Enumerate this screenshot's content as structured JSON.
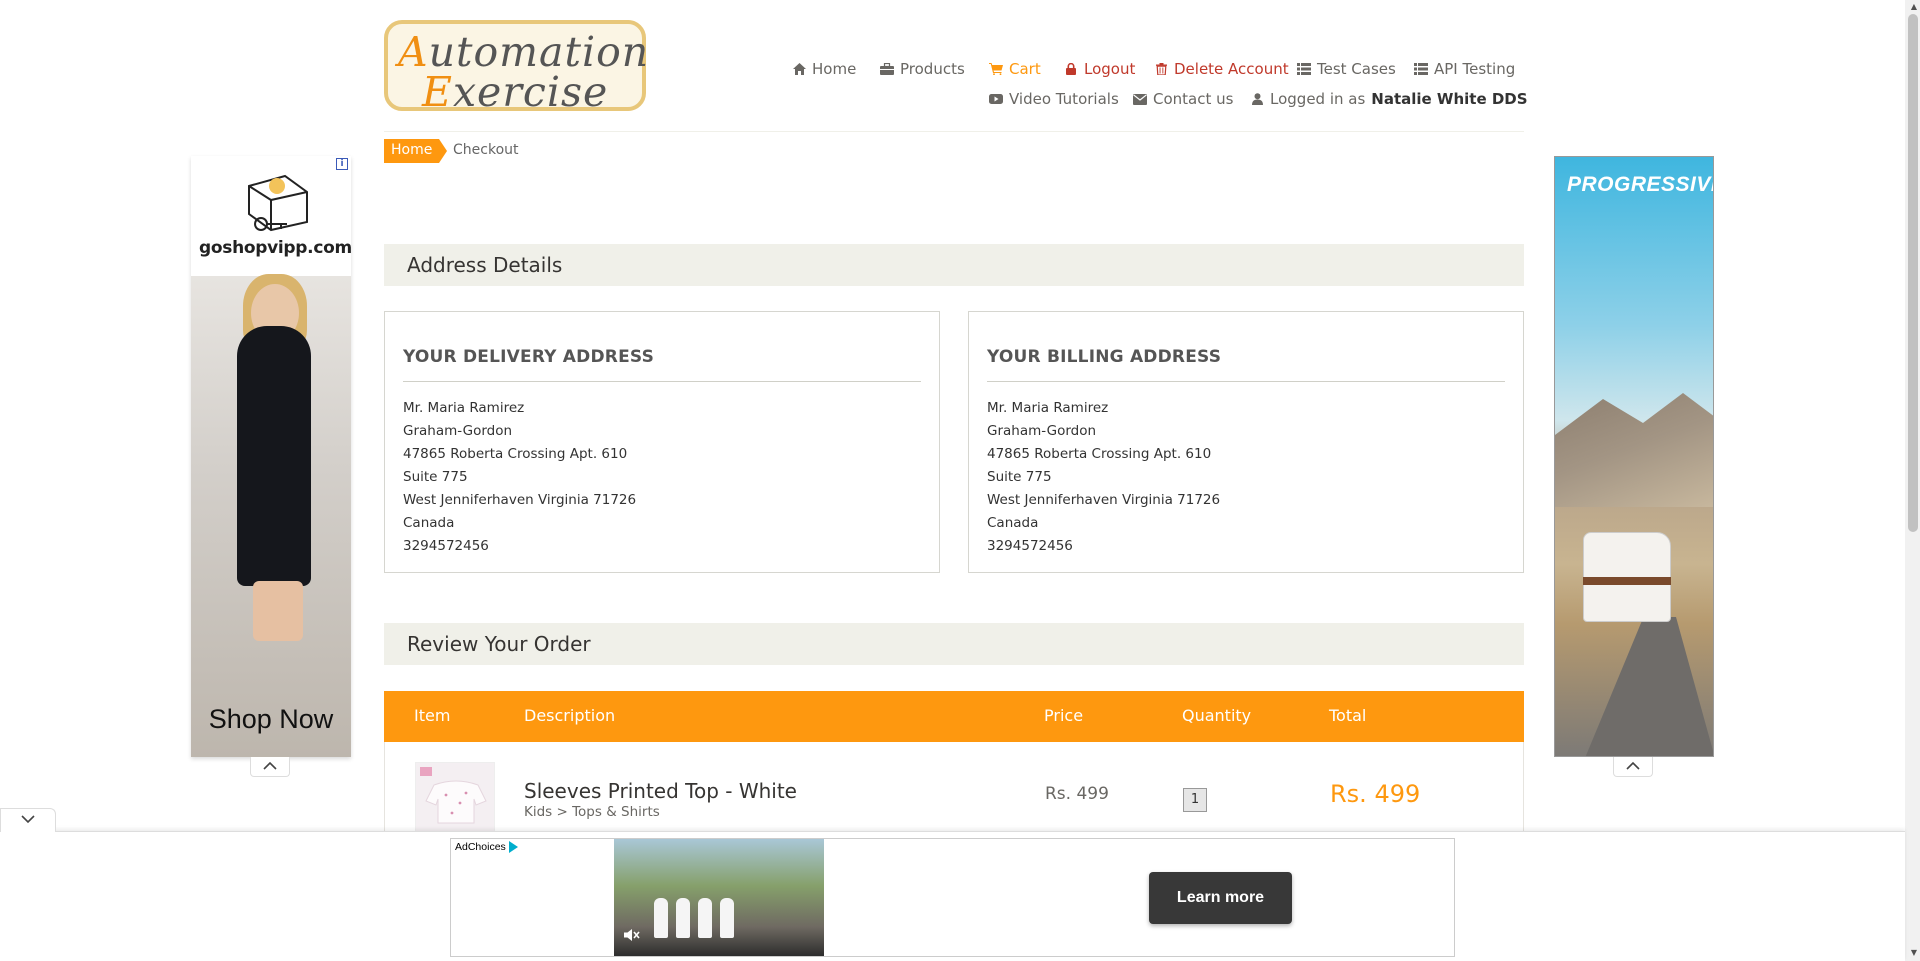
{
  "logo": {
    "line1_cap": "A",
    "line1_rest": "utomation",
    "line2_cap": "E",
    "line2_rest": "xercise"
  },
  "nav": {
    "home": "Home",
    "products": "Products",
    "cart": "Cart",
    "logout": "Logout",
    "delete_account": "Delete Account",
    "test_cases": "Test Cases",
    "api_testing": "API Testing",
    "video_tutorials": "Video Tutorials",
    "contact_us": "Contact us",
    "logged_in_prefix": "Logged in as",
    "logged_in_user": "Natalie White DDS"
  },
  "breadcrumb": {
    "home": "Home",
    "current": "Checkout"
  },
  "address_section": {
    "title": "Address Details"
  },
  "delivery": {
    "title": "YOUR DELIVERY ADDRESS",
    "lines": [
      "Mr. Maria Ramirez",
      "Graham-Gordon",
      "47865 Roberta Crossing Apt. 610",
      "Suite 775",
      "West Jenniferhaven Virginia 71726",
      "Canada",
      "3294572456"
    ]
  },
  "billing": {
    "title": "YOUR BILLING ADDRESS",
    "lines": [
      "Mr. Maria Ramirez",
      "Graham-Gordon",
      "47865 Roberta Crossing Apt. 610",
      "Suite 775",
      "West Jenniferhaven Virginia 71726",
      "Canada",
      "3294572456"
    ]
  },
  "review_section": {
    "title": "Review Your Order"
  },
  "order_table": {
    "headers": [
      "Item",
      "Description",
      "Price",
      "Quantity",
      "Total"
    ],
    "rows": [
      {
        "name": "Sleeves Printed Top - White",
        "category": "Kids > Tops & Shirts",
        "price": "Rs. 499",
        "quantity": "1",
        "total": "Rs. 499"
      }
    ]
  },
  "ads": {
    "left_brand": "goshopvipp.com",
    "left_cta": "Shop Now",
    "info_icon": "i",
    "right_brand": "PROGRESSIVE",
    "anchor_adchoices": "AdChoices",
    "anchor_cta": "Learn more"
  },
  "icons": {
    "home": "home-icon",
    "products": "briefcase-icon",
    "cart": "cart-icon",
    "logout": "lock-icon",
    "delete": "trash-icon",
    "test_cases": "list-icon",
    "api_testing": "list-icon",
    "video": "play-icon",
    "contact": "envelope-icon",
    "user": "user-icon"
  },
  "colors": {
    "accent": "#fe980f",
    "danger": "#c0392b",
    "section_bg": "#f0f0e9"
  }
}
